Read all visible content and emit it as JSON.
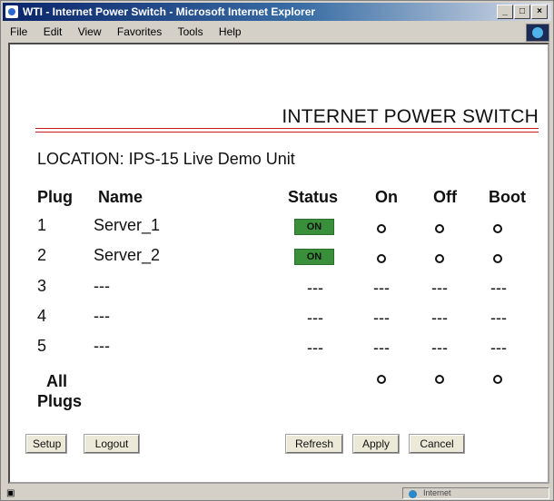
{
  "window": {
    "title": "WTI - Internet Power Switch - Microsoft Internet Explorer",
    "buttons": [
      "_",
      "□",
      "×"
    ]
  },
  "menubar": {
    "items": [
      "File",
      "Edit",
      "View",
      "Favorites",
      "Tools",
      "Help"
    ]
  },
  "page": {
    "heading": "INTERNET POWER SWITCH",
    "location": "LOCATION: IPS-15 Live Demo Unit",
    "columns": {
      "plug": "Plug",
      "name": "Name",
      "status": "Status",
      "on": "On",
      "off": "Off",
      "boot": "Boot"
    },
    "rows": [
      {
        "plug": "1",
        "name": "Server_1",
        "status": "ON"
      },
      {
        "plug": "2",
        "name": "Server_2",
        "status": "ON"
      },
      {
        "plug": "3",
        "name": "---",
        "status": "---",
        "on": "---",
        "off": "---",
        "boot": "---"
      },
      {
        "plug": "4",
        "name": "---",
        "status": "---",
        "on": "---",
        "off": "---",
        "boot": "---"
      },
      {
        "plug": "5",
        "name": "---",
        "status": "---",
        "on": "---",
        "off": "---",
        "boot": "---"
      }
    ],
    "all_plugs_line1": "All",
    "all_plugs_line2": "Plugs",
    "buttons": {
      "setup": "Setup",
      "logout": "Logout",
      "refresh": "Refresh",
      "apply": "Apply",
      "cancel": "Cancel"
    },
    "colors": {
      "status_on": "#3a8f3a",
      "rule": "#d01818"
    }
  },
  "statusbar": {
    "zone": "Internet"
  }
}
